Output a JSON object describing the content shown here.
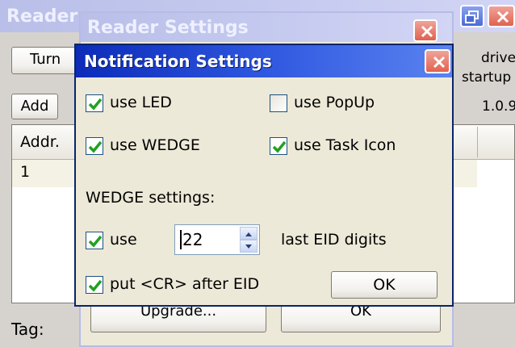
{
  "reader_window": {
    "title": "Reader",
    "turn_button": "Turn",
    "add_button": "Add",
    "table_header_addr": "Addr.",
    "table_row_1": "1",
    "tag_label": "Tag:",
    "right_text_driver": "driver",
    "right_text_startup": "startup",
    "right_text_version": "1.0.9"
  },
  "reader_settings": {
    "title": "Reader Settings",
    "upgrade_button": "Upgrade...",
    "ok_button": "OK"
  },
  "notification": {
    "title": "Notification Settings",
    "use_led": {
      "label": "use LED",
      "checked": true
    },
    "use_popup": {
      "label": "use PopUp",
      "checked": false
    },
    "use_wedge": {
      "label": "use WEDGE",
      "checked": true
    },
    "use_task_icon": {
      "label": "use Task Icon",
      "checked": true
    },
    "wedge_settings_label": "WEDGE settings:",
    "use_digits": {
      "label": "use",
      "checked": true
    },
    "digits_value": "22",
    "last_eid_digits_label": "last EID digits",
    "put_cr": {
      "label": "put <CR> after EID",
      "checked": true
    },
    "ok_button": "OK"
  },
  "colors": {
    "active_title": "#0b2bb8",
    "inactive_title": "#c0c5ee",
    "dialog_bg": "#ece9d8",
    "check_green": "#21a121",
    "close_red": "#e1624f"
  }
}
